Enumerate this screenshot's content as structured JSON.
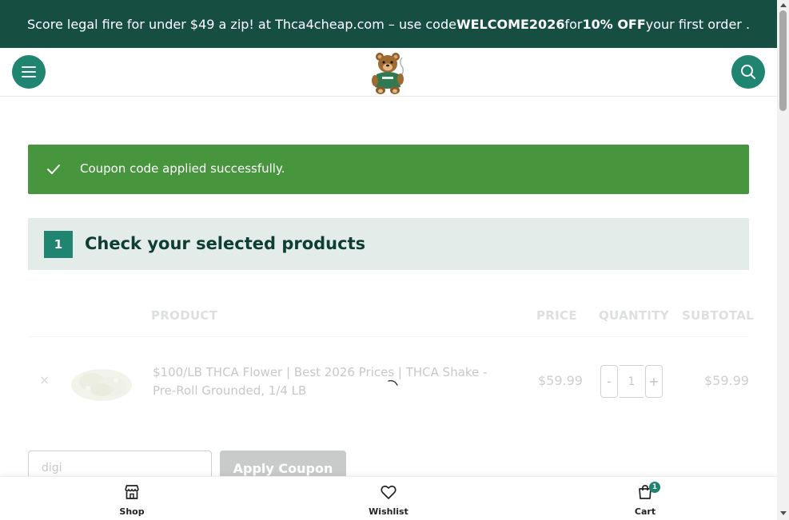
{
  "announcement": {
    "prefix": "Score legal fire for under $49 a zip! at Thca4cheap.com – use code ",
    "code": "WELCOME2026",
    "middle": " for ",
    "discount": "10% OFF",
    "suffix": " your first order ."
  },
  "header": {
    "menu_icon": "hamburger-menu-icon",
    "logo_icon": "teddy-bear-logo",
    "search_icon": "search-icon"
  },
  "notice": {
    "message": "Coupon code applied successfully.",
    "icon": "checkmark-icon",
    "color": "#47953d"
  },
  "step": {
    "number": "1",
    "title": "Check your selected products"
  },
  "cart": {
    "columns": {
      "product": "PRODUCT",
      "price": "PRICE",
      "quantity": "QUANTITY",
      "subtotal": "SUBTOTAL"
    },
    "items": [
      {
        "remove": "×",
        "name": "$100/LB THCA Flower | Best 2026 Prices | THCA Shake - Pre-Roll Grounded, 1/4 LB",
        "price": "$59.99",
        "quantity": "1",
        "minus": "-",
        "plus": "+",
        "subtotal": "$59.99"
      }
    ]
  },
  "coupon": {
    "value": "digi",
    "apply_label": "Apply Coupon"
  },
  "bottom_nav": {
    "shop": "Shop",
    "wishlist": "Wishlist",
    "cart": "Cart",
    "cart_count": "1"
  },
  "colors": {
    "brand_dark": "#164f42",
    "brand": "#1f8470",
    "step_bg": "#e3ece9"
  }
}
